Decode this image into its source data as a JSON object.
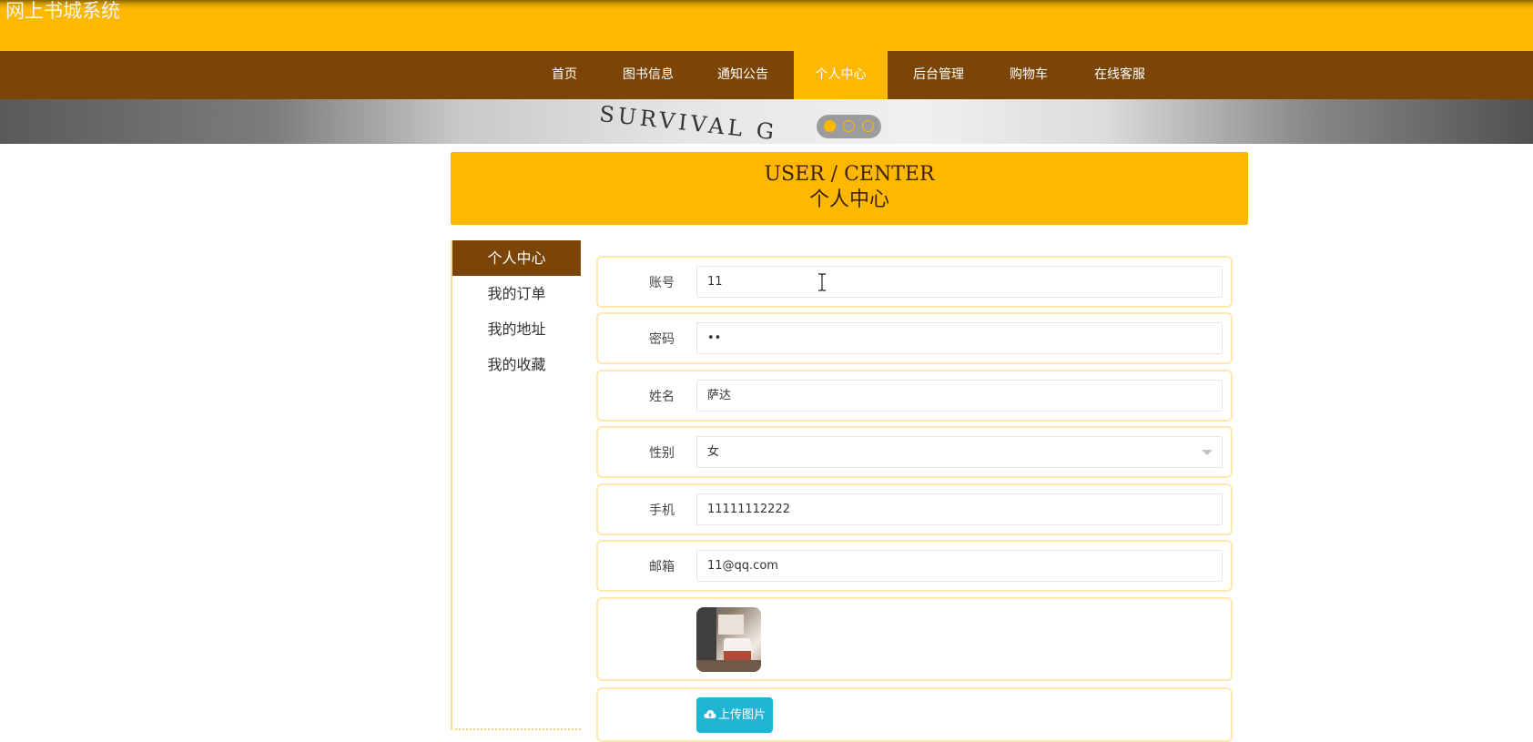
{
  "site": {
    "title": "网上书城系统"
  },
  "nav": {
    "items": [
      {
        "label": "首页"
      },
      {
        "label": "图书信息"
      },
      {
        "label": "通知公告"
      },
      {
        "label": "个人中心"
      },
      {
        "label": "后台管理"
      },
      {
        "label": "购物车"
      },
      {
        "label": "在线客服"
      }
    ],
    "active_index": 3
  },
  "banner": {
    "text": "SURVIVAL G",
    "slide_count": 3,
    "active_slide": 1
  },
  "hero": {
    "title_en": "USER / CENTER",
    "title_cn": "个人中心"
  },
  "sidebar": {
    "items": [
      {
        "label": "个人中心"
      },
      {
        "label": "我的订单"
      },
      {
        "label": "我的地址"
      },
      {
        "label": "我的收藏"
      }
    ],
    "active_index": 0
  },
  "form": {
    "account": {
      "label": "账号",
      "value": "11"
    },
    "password": {
      "label": "密码",
      "value": "••"
    },
    "name": {
      "label": "姓名",
      "value": "萨达"
    },
    "gender": {
      "label": "性别",
      "value": "女"
    },
    "phone": {
      "label": "手机",
      "value": "11111112222"
    },
    "email": {
      "label": "邮箱",
      "value": "11@qq.com"
    },
    "upload": {
      "label": "上传图片",
      "icon": "cloud-upload-icon"
    }
  },
  "colors": {
    "accent": "#ffb800",
    "nav_bg": "#7b4507",
    "upload_btn": "#1fb5d4"
  }
}
